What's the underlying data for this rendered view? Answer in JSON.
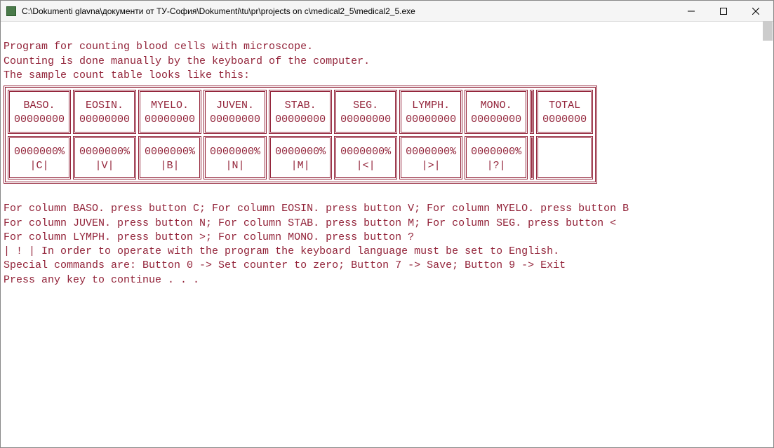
{
  "window": {
    "title": "C:\\Dokumenti glavna\\документи от ТУ-София\\Dokumenti\\tu\\pr\\projects on c\\medical2_5\\medical2_5.exe"
  },
  "intro": {
    "line1": "Program for counting blood cells with microscope.",
    "line2": "Counting is done manually by the keyboard of the computer.",
    "line3": "The sample count table looks like this:"
  },
  "table": {
    "headers": [
      "BASO.",
      "EOSIN.",
      "MYELO.",
      "JUVEN.",
      "STAB.",
      "SEG.",
      "LYMPH.",
      "MONO.",
      "TOTAL"
    ],
    "row1": [
      "00000000",
      "00000000",
      "00000000",
      "00000000",
      "00000000",
      "00000000",
      "00000000",
      "00000000",
      "0000000"
    ],
    "row2p": [
      "0000000%",
      "0000000%",
      "0000000%",
      "0000000%",
      "0000000%",
      "0000000%",
      "0000000%",
      "0000000%"
    ],
    "row2k": [
      "|C|",
      "|V|",
      "|B|",
      "|N|",
      "|M|",
      "|<|",
      "|>|",
      "|?|"
    ]
  },
  "help": {
    "l1": "For column BASO. press button C; For column EOSIN. press button V; For column MYELO. press button B",
    "l2": "For column JUVEN. press button N; For column STAB. press button M; For column SEG. press button <",
    "l3": "For column LYMPH. press button >; For column MONO. press button ?",
    "l4": "| ! | In order to operate with the program the keyboard language must be set to English.",
    "l5": "Special commands are: Button 0 -> Set counter to zero; Button 7 -> Save; Button 9 -> Exit",
    "l6": "Press any key to continue . . ."
  }
}
